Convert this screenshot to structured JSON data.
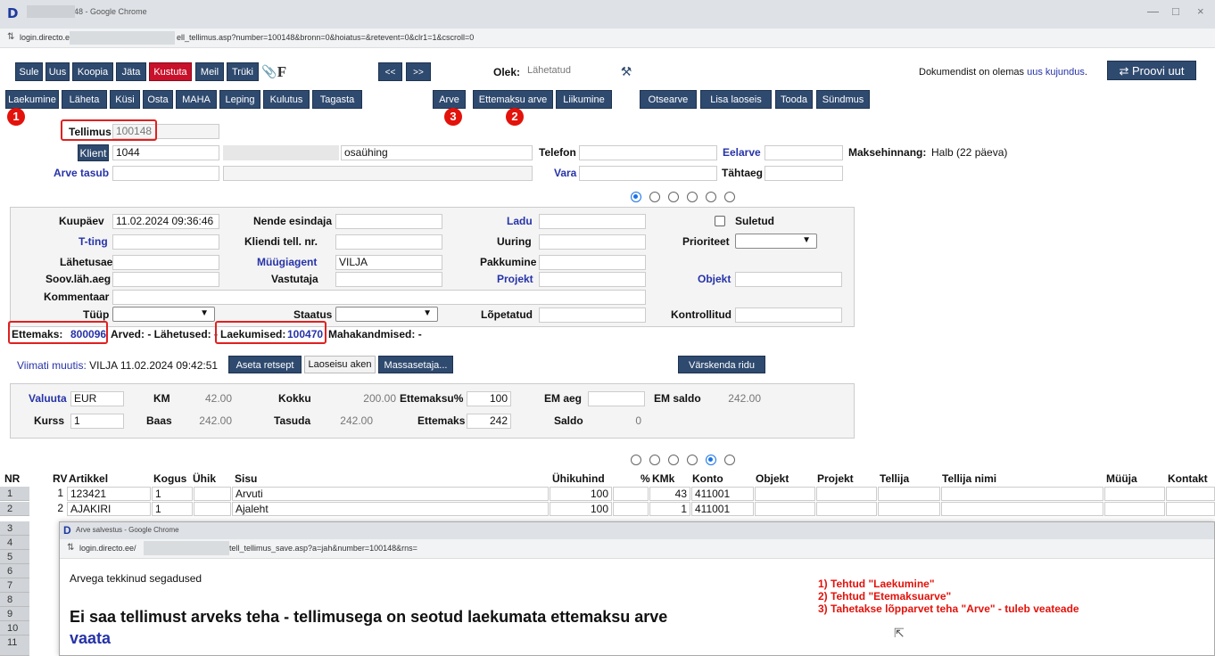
{
  "browser": {
    "title": "tellimus 100148 - Google Chrome",
    "url_host": "login.directo.ee/",
    "url_path": "ell_tellimus.asp?number=100148&bronn=0&hoiatus=&retevent=0&clr1=1&cscroll=0",
    "logo": "D",
    "minimize": "—",
    "maximize": "□",
    "close": "×"
  },
  "toolbar1": {
    "buttons": [
      "Sule",
      "Uus",
      "Koopia",
      "Jäta",
      "Kustuta",
      "Meil",
      "Trüki"
    ],
    "f_label": "F",
    "prev": "<<",
    "next": ">>",
    "status_label": "Olek:",
    "status_value": "Lähetatud",
    "doc_notice": "Dokumendist on olemas",
    "doc_notice_link": "uus kujundus",
    "try_new": "Proovi uut"
  },
  "toolbar2": {
    "buttons": [
      "Laekumine",
      "Läheta",
      "Küsi",
      "Osta",
      "MAHA",
      "Leping",
      "Kulutus",
      "Tagasta",
      "Arve",
      "Ettemaksu arve",
      "Liikumine",
      "Otsearve",
      "Lisa laoseis",
      "Tooda",
      "Sündmus"
    ]
  },
  "annotations": {
    "b1": "1",
    "b2": "2",
    "b3": "3"
  },
  "header": {
    "tellimus_label": "Tellimus",
    "tellimus_value": "100148",
    "klient_btn": "Klient",
    "klient_value": "1044",
    "klient_name": "osaühing",
    "telefon_label": "Telefon",
    "eelarve_label": "Eelarve",
    "maksehinnang_label": "Maksehinnang:",
    "maksehinnang_value": "Halb (22 päeva)",
    "arve_tasub_label": "Arve tasub",
    "vara_label": "Vara",
    "tahtaeg_label": "Tähtaeg"
  },
  "form": {
    "kuupaev_label": "Kuupäev",
    "kuupaev_value": "11.02.2024 09:36:46",
    "nende_esindaja_label": "Nende esindaja",
    "ladu_label": "Ladu",
    "suletud_label": "Suletud",
    "tting_label": "T-ting",
    "kliendi_tell_label": "Kliendi tell. nr.",
    "uuring_label": "Uuring",
    "prioriteet_label": "Prioriteet",
    "lahetusaeg_label": "Lähetusaeg",
    "muugiagent_label": "Müügiagent",
    "muugiagent_value": "VILJA",
    "pakkumine_label": "Pakkumine",
    "soov_label": "Soov.läh.aeg",
    "vastutaja_label": "Vastutaja",
    "projekt_label": "Projekt",
    "objekt_label": "Objekt",
    "kommentaar_label": "Kommentaar",
    "tuup_label": "Tüüp",
    "staatus_label": "Staatus",
    "lopetatud_label": "Lõpetatud",
    "kontrollitud_label": "Kontrollitud"
  },
  "links": {
    "ettemaks_label": "Ettemaks:",
    "ettemaks_value": "800096",
    "arved": "Arved: - Lähetused: -",
    "laekumised_label": "Laekumised:",
    "laekumised_value": "100470",
    "mahakandmised": "Mahakandmised: -"
  },
  "action_row": {
    "viimati_label": "Viimati muutis:",
    "viimati_value": "VILJA 11.02.2024 09:42:51",
    "aseta_retsept": "Aseta retsept",
    "laoseisu_aken": "Laoseisu aken",
    "massasetaja": "Massasetaja...",
    "varskenda": "Värskenda ridu"
  },
  "totals": {
    "valuuta_label": "Valuuta",
    "valuuta_value": "EUR",
    "km_label": "KM",
    "km_value": "42.00",
    "kokku_label": "Kokku",
    "kokku_value": "200.00",
    "ettemaksu_pct_label": "Ettemaksu%",
    "ettemaksu_pct_value": "100",
    "em_aeg_label": "EM aeg",
    "em_saldo_label": "EM saldo",
    "em_saldo_value": "242.00",
    "kurss_label": "Kurss",
    "kurss_value": "1",
    "baas_label": "Baas",
    "baas_value": "242.00",
    "tasuda_label": "Tasuda",
    "tasuda_value": "242.00",
    "ettemaks_label": "Ettemaks",
    "ettemaks_value": "242",
    "saldo_label": "Saldo",
    "saldo_value": "0"
  },
  "grid": {
    "headers": [
      "NR",
      "RV",
      "Artikkel",
      "Kogus",
      "Ühik",
      "Sisu",
      "Ühikuhind",
      "%",
      "KMk",
      "Konto",
      "Objekt",
      "Projekt",
      "Tellija",
      "Tellija nimi",
      "Müüja",
      "Kontakt"
    ],
    "rows": [
      {
        "nr": "1",
        "rv": "1",
        "artikkel": "123421",
        "kogus": "1",
        "sisu": "Arvuti",
        "hind": "100",
        "kmk": "43",
        "konto": "411001"
      },
      {
        "nr": "2",
        "rv": "2",
        "artikkel": "AJAKIRI",
        "kogus": "1",
        "sisu": "Ajaleht",
        "hind": "100",
        "kmk": "1",
        "konto": "411001"
      }
    ],
    "extra_rownums": [
      "3",
      "4",
      "5",
      "6",
      "7",
      "8",
      "9",
      "10",
      "11"
    ]
  },
  "popup": {
    "title": "Arve salvestus - Google Chrome",
    "url_host": "login.directo.ee/",
    "url_path": "tell_tellimus_save.asp?a=jah&number=100148&rns=",
    "subtitle": "Arvega tekkinud segadused",
    "error": "Ei saa tellimust arveks teha - tellimusega on seotud laekumata ettemaksu arve",
    "link": "vaata",
    "notes": [
      "1) Tehtud \"Laekumine\"",
      "2) Tehtud \"Etemaksuarve\"",
      "3) Tahetakse lõpparvet teha \"Arve\" - tuleb veateade"
    ]
  },
  "colors": {
    "button": "#2f4a6f",
    "danger": "#c8112b",
    "annotation": "#e3120b",
    "link": "#2633a8"
  }
}
